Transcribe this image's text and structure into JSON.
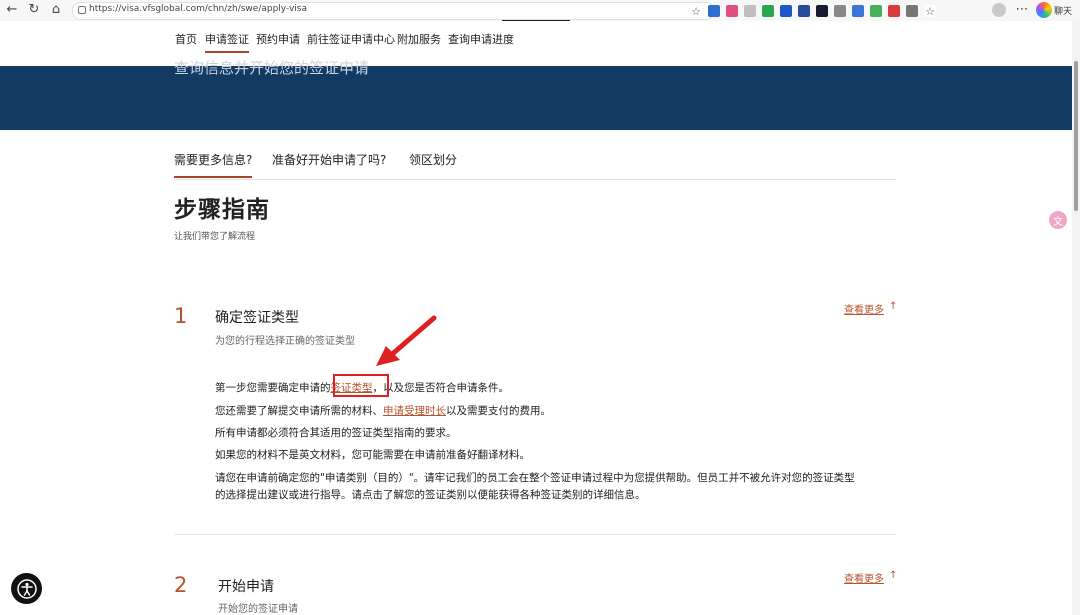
{
  "browser": {
    "url": "https://visa.vfsglobal.com/chn/zh/swe/apply-visa",
    "chat_label": "聊天",
    "back_icon": "←",
    "refresh_icon": "↻",
    "home_icon": "⌂"
  },
  "nav": {
    "items": [
      "首页",
      "申请签证",
      "预约申请",
      "前往签证申请中心",
      "附加服务",
      "查询申请进度"
    ],
    "active_index": 1
  },
  "hero": {
    "text": "查询信息并开始您的签证申请"
  },
  "tabs": [
    "需要更多信息?",
    "准备好开始申请了吗?",
    "领区划分"
  ],
  "page": {
    "title": "步骤指南",
    "subtitle": "让我们带您了解流程"
  },
  "steps": [
    {
      "number": "1",
      "title": "确定签证类型",
      "desc": "为您的行程选择正确的签证类型",
      "see_more": "查看更多",
      "arrow": "↑"
    },
    {
      "number": "2",
      "title": "开始申请",
      "desc": "开始您的签证申请",
      "see_more": "查看更多",
      "arrow": "↑"
    }
  ],
  "step1_body": {
    "line1_pre": "第一步您需要确定申请的",
    "line1_link": "签证类型",
    "line1_post": "，以及您是否符合申请条件。",
    "line2_pre": "您还需要了解提交申请所需的材料、",
    "line2_link": "申请受理时长",
    "line2_post": "以及需要支付的费用。",
    "line3": "所有申请都必须符合其适用的签证类型指南的要求。",
    "line4": "如果您的材料不是英文材料，您可能需要在申请前准备好翻译材料。",
    "line5": "请您在申请前确定您的\"申请类别（目的）\"。请牢记我们的员工会在整个签证申请过程中为您提供帮助。但员工并不被允许对您的签证类型",
    "line6": "的选择提出建议或进行指导。请点击了解您的签证类别以便能获得各种签证类别的详细信息。"
  },
  "colors": {
    "accent": "#b5532e",
    "hero": "#123a63",
    "annotation": "#e02020"
  }
}
